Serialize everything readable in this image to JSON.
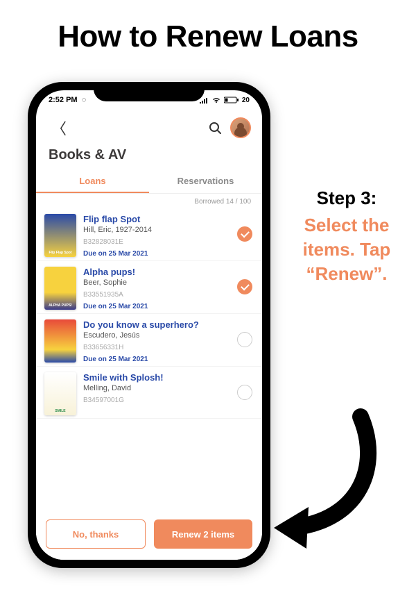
{
  "headline": "How to Renew Loans",
  "instructions": {
    "step_label": "Step 3:",
    "step_text": "Select the items. Tap “Renew”."
  },
  "status": {
    "time": "2:52 PM",
    "battery": "20"
  },
  "section_title": "Books & AV",
  "tabs": {
    "loans": "Loans",
    "reservations": "Reservations",
    "active": "loans"
  },
  "borrowed_text": "Borrowed 14 / 100",
  "items": [
    {
      "title": "Flip flap Spot",
      "author": "Hill, Eric, 1927-2014",
      "barcode": "B32828031E",
      "due": "Due on 25 Mar 2021",
      "selected": true
    },
    {
      "title": "Alpha pups!",
      "author": "Beer, Sophie",
      "barcode": "B33551935A",
      "due": "Due on 25 Mar 2021",
      "selected": true
    },
    {
      "title": "Do you know a superhero?",
      "author": "Escudero, Jesús",
      "barcode": "B33656331H",
      "due": "Due on 25 Mar 2021",
      "selected": false
    },
    {
      "title": "Smile with Splosh!",
      "author": "Melling, David",
      "barcode": "B34597001G",
      "due": "",
      "selected": false
    }
  ],
  "buttons": {
    "secondary": "No, thanks",
    "primary": "Renew 2 items"
  },
  "colors": {
    "accent": "#f08a5d",
    "link": "#2a4aa8"
  }
}
